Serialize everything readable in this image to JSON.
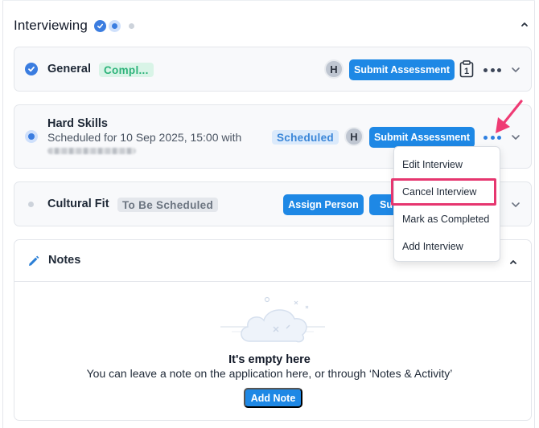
{
  "section": {
    "title": "Interviewing"
  },
  "stages": [
    {
      "name": "General",
      "status": "Compl...",
      "avatar": "H",
      "submit_label": "Submit Assessment",
      "count": "1"
    },
    {
      "name": "Hard Skills",
      "scheduled_text": "Scheduled for 10 Sep 2025, 15:00 with",
      "status": "Scheduled",
      "avatar": "H",
      "submit_label": "Submit Assessment"
    },
    {
      "name": "Cultural Fit",
      "status": "To Be Scheduled",
      "assign_label": "Assign Person",
      "submit_label_truncated": "Su"
    }
  ],
  "menu": {
    "items": [
      "Edit Interview",
      "Cancel Interview",
      "Mark as Completed",
      "Add Interview"
    ],
    "highlighted": "Cancel Interview"
  },
  "notes": {
    "title": "Notes",
    "empty_title": "It's empty here",
    "empty_sub": "You can leave a note on the application here, or through ‘Notes & Activity’",
    "add_label": "Add Note"
  },
  "colors": {
    "primary": "#1e88e5",
    "complete": "#2db37a",
    "scheduled": "#3a86d8",
    "highlight": "#e6366f"
  },
  "icons": {
    "check": "check-icon",
    "more": "more-dots-icon",
    "chevron": "chevron-down-icon",
    "pencil": "pencil-icon",
    "clipboard": "clipboard-icon",
    "cloud": "cloud-illustration"
  }
}
